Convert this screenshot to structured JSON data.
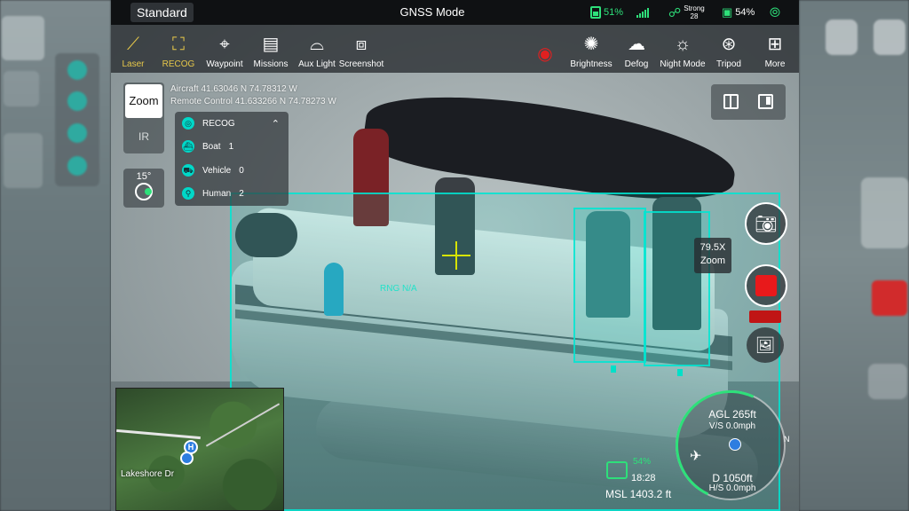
{
  "topbar": {
    "mode": "Standard",
    "gnss": "GNSS Mode",
    "rc_battery": "51%",
    "signal_label": "Strong",
    "signal_value": "28",
    "drone_battery": "54%",
    "signal_bars": [
      3,
      5,
      7,
      9,
      11
    ]
  },
  "toolbar": {
    "items": [
      {
        "label": "Laser",
        "icon": "laser-icon",
        "active": true
      },
      {
        "label": "RECOG",
        "icon": "recog-icon",
        "active": true
      },
      {
        "label": "Waypoint",
        "icon": "waypoint-icon"
      },
      {
        "label": "Missions",
        "icon": "missions-icon"
      },
      {
        "label": "Aux Light",
        "icon": "aux-light-icon"
      },
      {
        "label": "Screenshot",
        "icon": "screenshot-icon"
      },
      {
        "label": "",
        "icon": "record-icon",
        "recording": true
      },
      {
        "label": "Brightness",
        "icon": "brightness-icon"
      },
      {
        "label": "Defog",
        "icon": "defog-icon"
      },
      {
        "label": "Night Mode",
        "icon": "night-mode-icon"
      },
      {
        "label": "Tripod",
        "icon": "tripod-icon"
      },
      {
        "label": "More",
        "icon": "more-icon"
      }
    ]
  },
  "coords": {
    "aircraft": "Aircraft  41.63046 N  74.78312 W",
    "remote": "Remote Control 41.633266 N  74.78273 W"
  },
  "camera_panel": {
    "zoom_label": "Zoom",
    "ir_label": "IR",
    "gimbal_angle": "15°"
  },
  "recog": {
    "title": "RECOG",
    "rows": [
      {
        "label": "Boat",
        "count": "1"
      },
      {
        "label": "Vehicle",
        "count": "0"
      },
      {
        "label": "Human",
        "count": "2"
      }
    ]
  },
  "overlay": {
    "zoom_tag_value": "79.5X",
    "zoom_tag_label": "Zoom",
    "rng": "RNG  N/A"
  },
  "minimap": {
    "street": "Lakeshore Dr",
    "home_marker": "H"
  },
  "telemetry": {
    "signal_pct": "54%",
    "time": "18:28",
    "msl": "MSL 1403.2 ft",
    "agl": "AGL 265ft",
    "vs": "V/S 0.0mph",
    "distance": "D 1050ft",
    "hs": "H/S 0.0mph",
    "north": "N"
  },
  "colors": {
    "accent_green": "#2ee07a",
    "detection": "#00e0c8",
    "record_red": "#e8191b",
    "active_tool": "#e7c84a"
  }
}
